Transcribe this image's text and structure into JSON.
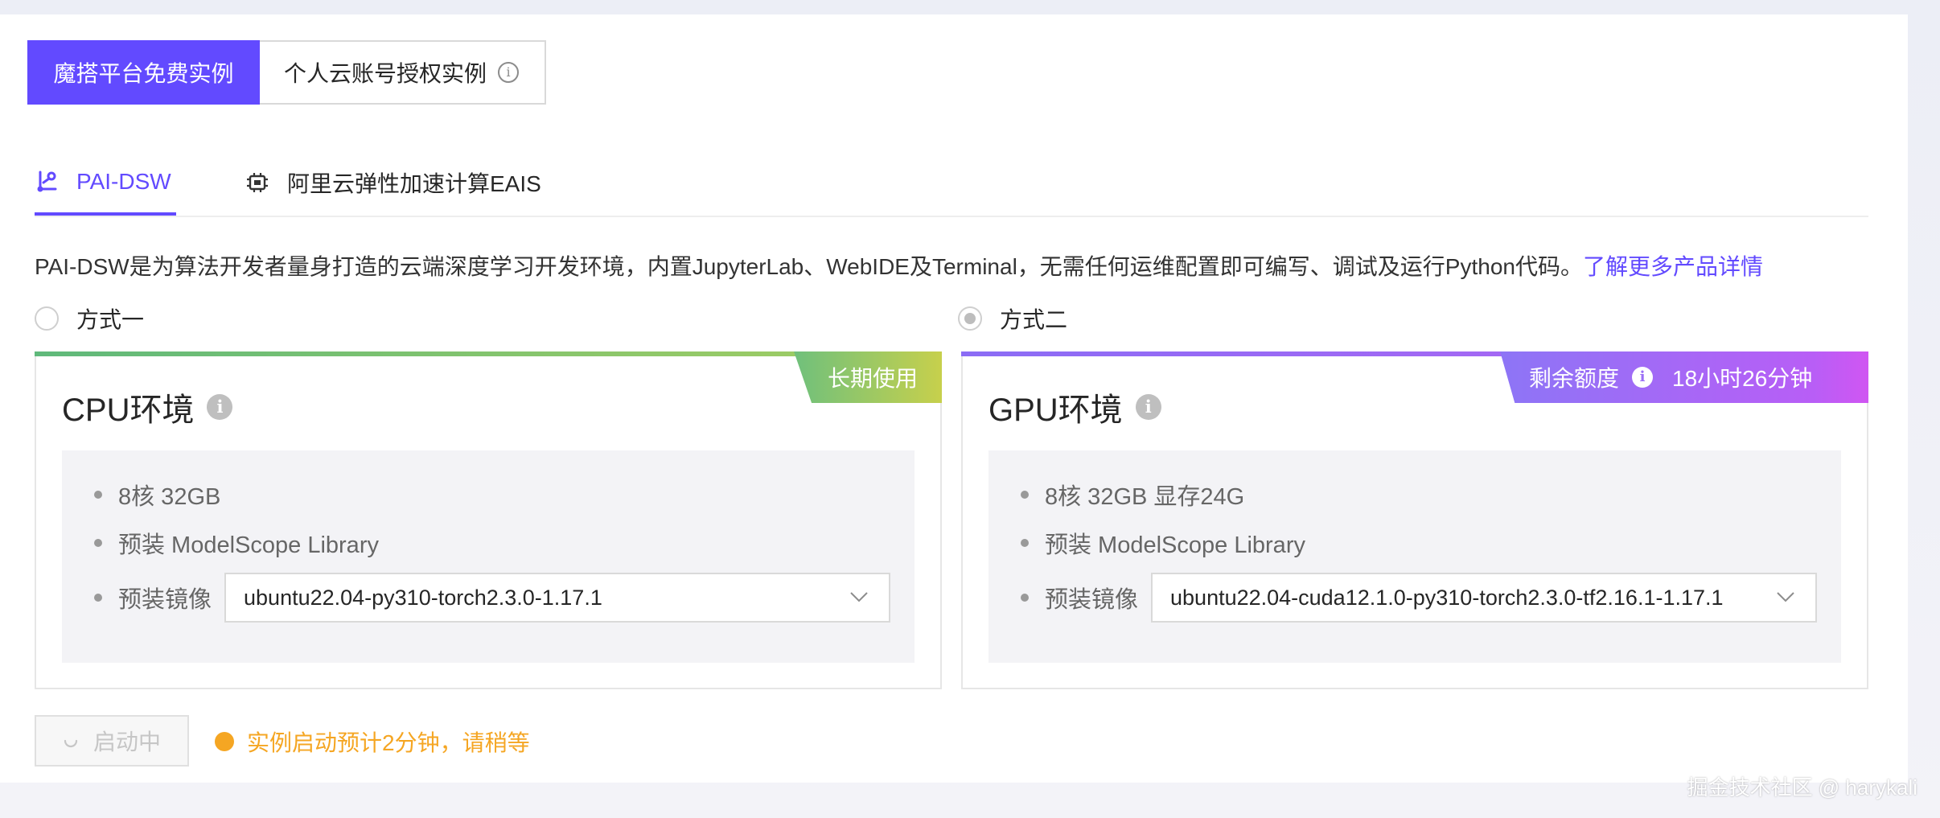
{
  "top_tabs": {
    "free_instance": "魔搭平台免费实例",
    "personal_cloud": "个人云账号授权实例"
  },
  "sub_tabs": {
    "dsw": "PAI-DSW",
    "eais": "阿里云弹性加速计算EAIS"
  },
  "description": {
    "text": "PAI-DSW是为算法开发者量身打造的云端深度学习开发环境，内置JupyterLab、WebIDE及Terminal，无需任何运维配置即可编写、调试及运行Python代码。",
    "link": "了解更多产品详情"
  },
  "options": {
    "option1": "方式一",
    "option2": "方式二",
    "selected": "option2"
  },
  "cpu_card": {
    "title": "CPU环境",
    "ribbon": "长期使用",
    "spec1": "8核 32GB",
    "spec2": "预装 ModelScope Library",
    "image_label": "预装镜像",
    "image_value": "ubuntu22.04-py310-torch2.3.0-1.17.1"
  },
  "gpu_card": {
    "title": "GPU环境",
    "ribbon_label": "剩余额度",
    "ribbon_value": "18小时26分钟",
    "spec1": "8核 32GB 显存24G",
    "spec2": "预装 ModelScope Library",
    "image_label": "预装镜像",
    "image_value": "ubuntu22.04-cuda12.1.0-py310-torch2.3.0-tf2.16.1-1.17.1"
  },
  "footer": {
    "button_label": "启动中",
    "status_text": "实例启动预计2分钟，请稍等"
  },
  "watermark": "掘金技术社区 @ harykali",
  "colors": {
    "primary": "#624aff",
    "warning": "#f5a623",
    "cpu_gradient": [
      "#6fc07c",
      "#c7d04c"
    ],
    "gpu_gradient": [
      "#8d75f6",
      "#d056f2"
    ]
  }
}
